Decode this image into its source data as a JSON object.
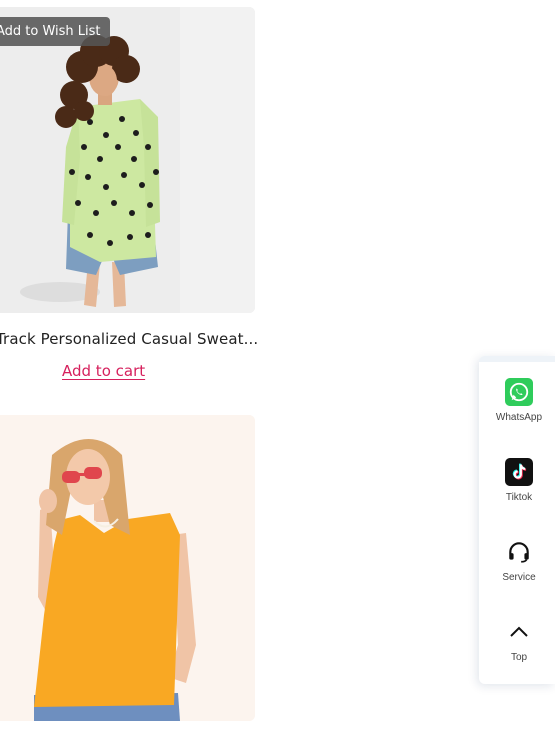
{
  "products": [
    {
      "wishlist_label": "Add to Wish List",
      "title": "Track Personalized Casual Sweater Shirt",
      "add_to_cart": "Add to cart"
    },
    {
      "title": ""
    }
  ],
  "float_panel": {
    "items": [
      {
        "label": "WhatsApp",
        "icon": "whatsapp-icon"
      },
      {
        "label": "Tiktok",
        "icon": "tiktok-icon"
      },
      {
        "label": "Service",
        "icon": "headset-icon"
      },
      {
        "label": "Top",
        "icon": "chevron-up-icon"
      }
    ]
  },
  "colors": {
    "accent": "#d6215d",
    "whatsapp": "#2fcc5b",
    "tiktok": "#111111"
  }
}
